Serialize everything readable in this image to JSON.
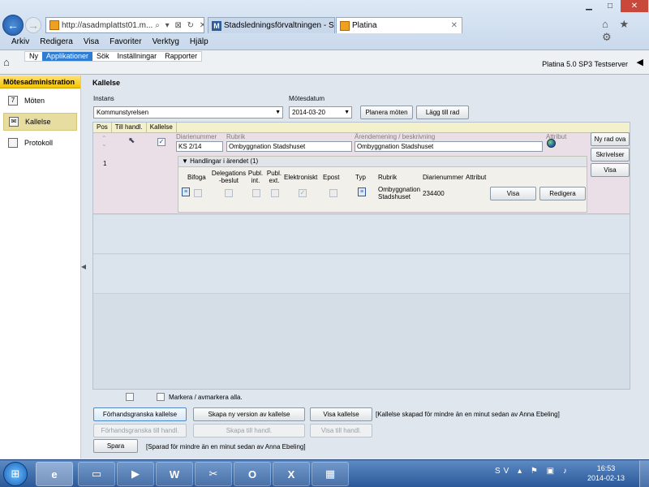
{
  "browser": {
    "address": "http://asadmplattst01.m...",
    "address_icons": "⌕ ▾ ⊠ ↻ ✕",
    "tabs": [
      {
        "label": "Stadsledningsförvaltningen - S..."
      },
      {
        "label": "Platina",
        "close": "✕"
      }
    ],
    "toolbar_icons": "⌂ ★ ⚙",
    "menu": [
      "Arkiv",
      "Redigera",
      "Visa",
      "Favoriter",
      "Verktyg",
      "Hjälp"
    ]
  },
  "app": {
    "menu": [
      "Ny",
      "Applikationer",
      "Sök",
      "Inställningar",
      "Rapporter"
    ],
    "product": "Platina 5.0 SP3 Testserver"
  },
  "sidebar": {
    "title": "Mötesadministration",
    "items": [
      {
        "label": "Möten",
        "icon": "calendar-icon"
      },
      {
        "label": "Kallelse",
        "icon": "envelope-icon"
      },
      {
        "label": "Protokoll",
        "icon": "notepad-icon"
      }
    ]
  },
  "main": {
    "title": "Kallelse",
    "instans_label": "Instans",
    "instans_value": "Kommunstyrelsen",
    "motesdatum_label": "Mötesdatum",
    "motesdatum_value": "2014-03-20",
    "planera_button": "Planera möten",
    "lagg_till_button": "Lägg till rad",
    "grid_headers": [
      "Pos",
      "Till handl.",
      "Kallelse"
    ],
    "row": {
      "number": "1",
      "diarienummer_label": "Diarienummer",
      "diarienummer_value": "KS 2/14",
      "rubrik_label": "Rubrik",
      "rubrik_value": "Ombyggnation Stadshuset",
      "arendemening_label": "Ärendemening / beskrivning",
      "arendemening_value": "Ombyggnation Stadshuset",
      "attribut_label": "Attribut",
      "side_buttons": [
        "Ny rad ova",
        "Skrivelser",
        "Visa"
      ]
    },
    "handlingar": {
      "title": "Handlingar i ärendet (1)",
      "columns": [
        "Bifoga",
        "Delegations\n-beslut",
        "Publ.\nint.",
        "Publ.\next.",
        "Elektroniskt",
        "Epost",
        "Typ",
        "Rubrik",
        "Diarienummer",
        "Attribut"
      ],
      "row_rubrik": "Ombyggnation\nStadshuset",
      "row_diarienummer": "234400",
      "visa_button": "Visa",
      "redigera_button": "Redigera"
    },
    "markera_label": "Markera / avmarkera alla.",
    "buttons": {
      "forhandsgranska_kallelse": "Förhandsgranska kallelse",
      "skapa_ny_version": "Skapa ny version av kallelse",
      "visa_kallelse": "Visa kallelse",
      "forhandsgranska_till_handl": "Förhandsgranska till handl.",
      "skapa_till_handl": "Skapa till handl.",
      "visa_till_handl": "Visa till handl.",
      "spara": "Spara"
    },
    "kallelse_status": "[Kallelse skapad för mindre än en minut sedan av Anna Ebeling]",
    "spara_status": "[Sparad för mindre än en minut sedan av Anna Ebeling]"
  },
  "taskbar": {
    "language": "SV",
    "time": "16:53",
    "date": "2014-02-13"
  }
}
